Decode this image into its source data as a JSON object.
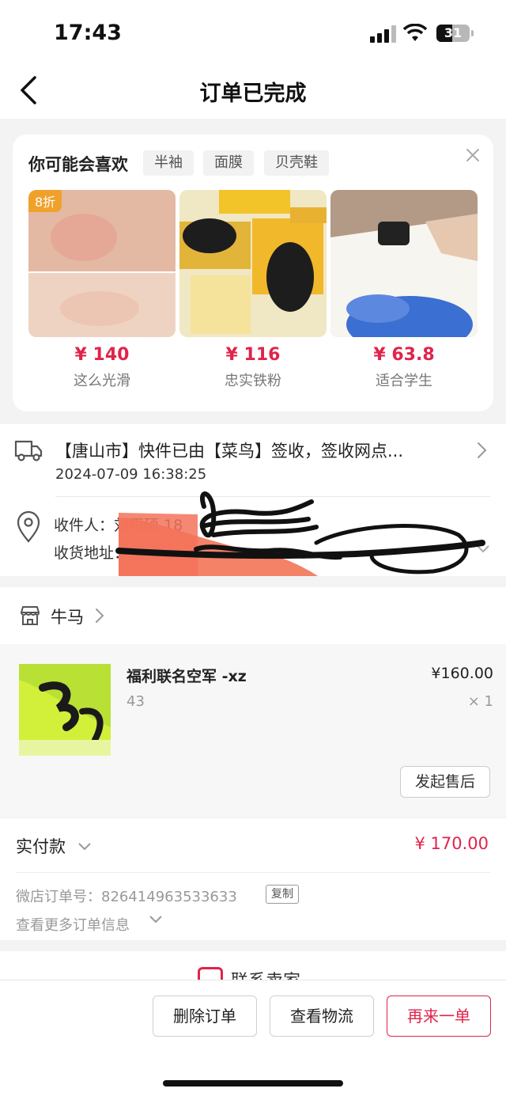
{
  "status_bar": {
    "time": "17:43",
    "battery": "31"
  },
  "nav": {
    "title": "订单已完成"
  },
  "recommend": {
    "title": "你可能会喜欢",
    "chips": [
      "半袖",
      "面膜",
      "贝壳鞋"
    ],
    "products": [
      {
        "badge": "8折",
        "price": "¥ 140",
        "name": "这么光滑"
      },
      {
        "price": "¥ 116",
        "name": "忠实铁粉"
      },
      {
        "price": "¥ 63.8",
        "name": "适合学生"
      }
    ]
  },
  "logistics": {
    "status": "【唐山市】快件已由【菜鸟】签收，签收网点...",
    "time": "2024-07-09 16:38:25",
    "recipient": "收件人：刘雨硕  18",
    "address": "收货地址：河北省"
  },
  "shop": {
    "name": "牛马",
    "item": {
      "title": "福利联名空军 -xz",
      "spec": "43",
      "price": "¥160.00",
      "qty": "× 1"
    },
    "aftersale_label": "发起售后"
  },
  "payment": {
    "label": "实付款",
    "amount": "¥ 170.00",
    "order_no": "微店订单号：826414963533633",
    "copy_label": "复制",
    "more_info": "查看更多订单信息"
  },
  "contact": {
    "label": "联系卖家"
  },
  "actions": {
    "delete": "删除订单",
    "logistics": "查看物流",
    "reorder": "再来一单"
  },
  "colors": {
    "accent": "#e0244a",
    "badge": "#f0a12a"
  }
}
